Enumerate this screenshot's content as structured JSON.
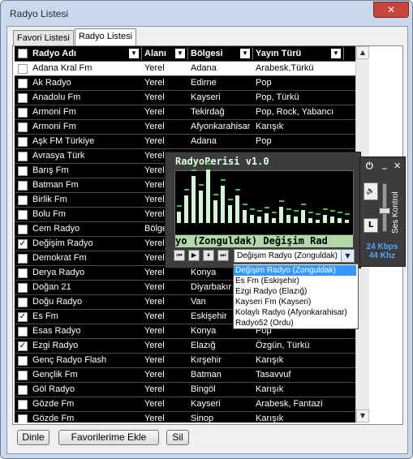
{
  "window": {
    "title": "Radyo Listesi",
    "close_label": "✕"
  },
  "tabs": [
    {
      "label": "Favori Listesi"
    },
    {
      "label": "Radyo Listesi"
    }
  ],
  "columns": [
    {
      "label": "Radyo Adı"
    },
    {
      "label": "Alanı"
    },
    {
      "label": "Bölgesi"
    },
    {
      "label": "Yayın Türü"
    }
  ],
  "rows": [
    {
      "checked": false,
      "name": "Adana Kral Fm",
      "area": "Yerel",
      "region": "Adana",
      "genre": "Arabesk,Türkü",
      "selected": true
    },
    {
      "checked": false,
      "name": "Ak Radyo",
      "area": "Yerel",
      "region": "Edirne",
      "genre": "Pop"
    },
    {
      "checked": false,
      "name": "Anadolu Fm",
      "area": "Yerel",
      "region": "Kayseri",
      "genre": "Pop, Türkü"
    },
    {
      "checked": false,
      "name": "Armoni Fm",
      "area": "Yerel",
      "region": "Tekirdağ",
      "genre": "Pop, Rock, Yabancı"
    },
    {
      "checked": false,
      "name": "Armoni Fm",
      "area": "Yerel",
      "region": "Afyonkarahisar",
      "genre": "Karışık"
    },
    {
      "checked": false,
      "name": "Aşk FM Türkiye",
      "area": "Yerel",
      "region": "Adana",
      "genre": "Pop"
    },
    {
      "checked": false,
      "name": "Avrasya Türk",
      "area": "Yerel",
      "region": "",
      "genre": ""
    },
    {
      "checked": false,
      "name": "Barış Fm",
      "area": "Yerel",
      "region": "",
      "genre": ""
    },
    {
      "checked": false,
      "name": "Batman Fm",
      "area": "Yerel",
      "region": "",
      "genre": ""
    },
    {
      "checked": false,
      "name": "Birlik Fm",
      "area": "Yerel",
      "region": "",
      "genre": ""
    },
    {
      "checked": false,
      "name": "Bolu Fm",
      "area": "Yerel",
      "region": "",
      "genre": ""
    },
    {
      "checked": false,
      "name": "Cem Radyo",
      "area": "Bölgesel",
      "region": "",
      "genre": ""
    },
    {
      "checked": true,
      "name": "Değişim Radyo",
      "area": "Yerel",
      "region": "",
      "genre": ""
    },
    {
      "checked": false,
      "name": "Demokrat Fm",
      "area": "Yerel",
      "region": "",
      "genre": ""
    },
    {
      "checked": false,
      "name": "Derya Radyo",
      "area": "Yerel",
      "region": "Konya",
      "genre": ""
    },
    {
      "checked": false,
      "name": "Doğan 21",
      "area": "Yerel",
      "region": "Diyarbakır",
      "genre": ""
    },
    {
      "checked": false,
      "name": "Doğu Radyo",
      "area": "Yerel",
      "region": "Van",
      "genre": ""
    },
    {
      "checked": true,
      "name": "Es Fm",
      "area": "Yerel",
      "region": "Eskişehir",
      "genre": ""
    },
    {
      "checked": false,
      "name": "Esas Radyo",
      "area": "Yerel",
      "region": "Konya",
      "genre": "Pop"
    },
    {
      "checked": true,
      "name": "Ezgi Radyo",
      "area": "Yerel",
      "region": "Elazığ",
      "genre": "Özgün, Türkü"
    },
    {
      "checked": false,
      "name": "Genç Radyo Flash",
      "area": "Yerel",
      "region": "Kırşehir",
      "genre": "Karışık"
    },
    {
      "checked": false,
      "name": "Gençlik Fm",
      "area": "Yerel",
      "region": "Batman",
      "genre": "Tasavvuf"
    },
    {
      "checked": false,
      "name": "Göl Radyo",
      "area": "Yerel",
      "region": "Bingöl",
      "genre": "Karışık"
    },
    {
      "checked": false,
      "name": "Gözde Fm",
      "area": "Yerel",
      "region": "Kayseri",
      "genre": "Arabesk, Fantazi"
    },
    {
      "checked": false,
      "name": "Gözde Fm",
      "area": "Yerel",
      "region": "Sinop",
      "genre": "Karışık"
    }
  ],
  "buttons": {
    "listen": "Dinle",
    "add_fav": "Favorilerime Ekle",
    "delete": "Sil"
  },
  "player": {
    "title": "RadyoPerisi v1.0",
    "scroll_text": "yo (Zonguldak)  Değişim Rad",
    "station_select": "Değişim Radyo (Zonguldak)",
    "dropdown": [
      "Değişim Radyo (Zonguldak)",
      "Es Fm (Eskişehir)",
      "Ezgi Radyo (Elazığ)",
      "Kayseri Fm (Kayseri)",
      "Kolaylı Radyo (Afyonkarahisar)",
      "Radyo52 (Ordu)"
    ],
    "side": {
      "power": "⏻",
      "minimize": "_",
      "close": "✕",
      "volume_label": "Ses Kontrol",
      "lock": "L",
      "bitrate": "24 Kbps",
      "samplerate": "44 Khz"
    }
  },
  "colors": {
    "row_bg": "#000000",
    "row_text": "#ffffff",
    "selected_bg": "#ffffff",
    "dropdown_highlight": "#3399ff",
    "player_bg": "#3c3c3c",
    "rate_text": "#4aa8ff"
  }
}
